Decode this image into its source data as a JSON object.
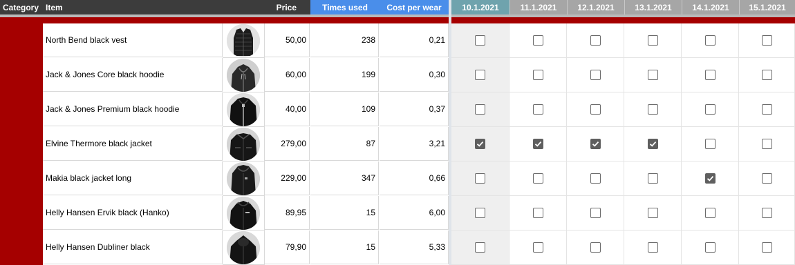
{
  "header": {
    "category": "Category",
    "item": "Item",
    "price": "Price",
    "times_used": "Times used",
    "cost_per_wear": "Cost per wear",
    "dates": [
      "10.1.2021",
      "11.1.2021",
      "12.1.2021",
      "13.1.2021",
      "14.1.2021",
      "15.1.2021"
    ]
  },
  "rows": [
    {
      "name": "North Bend black vest",
      "price": "50,00",
      "times": "238",
      "cpw": "0,21",
      "checks": [
        false,
        false,
        false,
        false,
        false,
        false
      ],
      "thumb": "vest"
    },
    {
      "name": "Jack & Jones Core black hoodie",
      "price": "60,00",
      "times": "199",
      "cpw": "0,30",
      "checks": [
        false,
        false,
        false,
        false,
        false,
        false
      ],
      "thumb": "hoodie-gray"
    },
    {
      "name": "Jack & Jones Premium black hoodie",
      "price": "40,00",
      "times": "109",
      "cpw": "0,37",
      "checks": [
        false,
        false,
        false,
        false,
        false,
        false
      ],
      "thumb": "hoodie-black"
    },
    {
      "name": "Elvine Thermore black jacket",
      "price": "279,00",
      "times": "87",
      "cpw": "3,21",
      "checks": [
        true,
        true,
        true,
        true,
        false,
        false
      ],
      "thumb": "jacket"
    },
    {
      "name": "Makia black jacket long",
      "price": "229,00",
      "times": "347",
      "cpw": "0,66",
      "checks": [
        false,
        false,
        false,
        false,
        true,
        false
      ],
      "thumb": "jacket-long"
    },
    {
      "name": "Helly Hansen Ervik black (Hanko)",
      "price": "89,95",
      "times": "15",
      "cpw": "6,00",
      "checks": [
        false,
        false,
        false,
        false,
        false,
        false
      ],
      "thumb": "jacket-hood"
    },
    {
      "name": "Helly Hansen Dubliner black",
      "price": "79,90",
      "times": "15",
      "cpw": "5,33",
      "checks": [
        false,
        false,
        false,
        false,
        false,
        false
      ],
      "thumb": "jacket-hood2"
    }
  ],
  "colors": {
    "category_red": "#a50000",
    "header_dark": "#3c3c3c",
    "header_blue": "#4a8eea",
    "today_teal": "#6fa3ad",
    "date_gray": "#a6a6a6"
  }
}
